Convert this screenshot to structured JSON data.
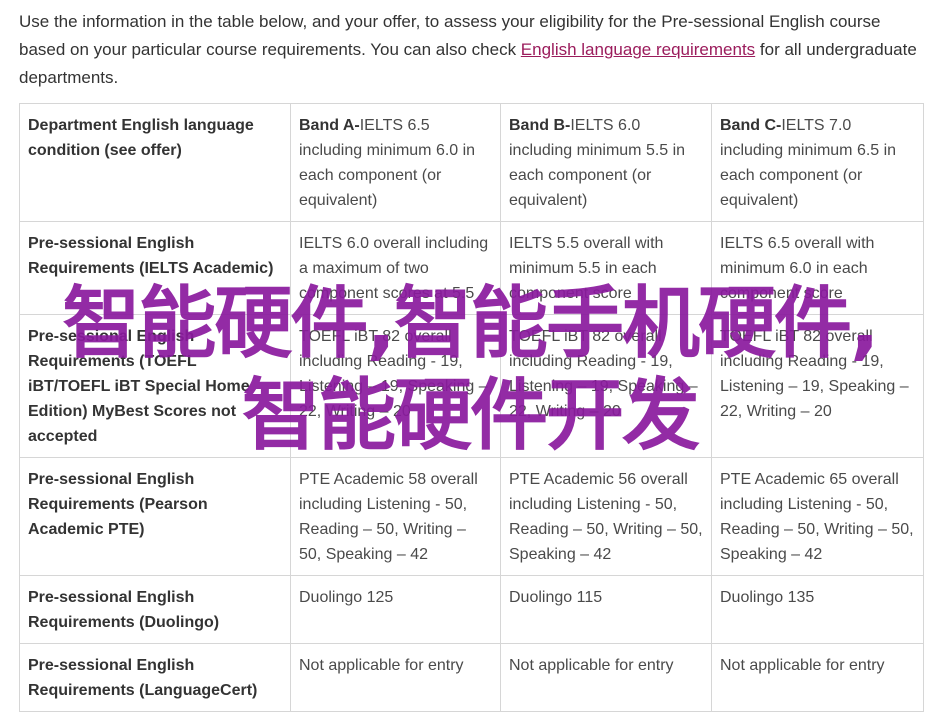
{
  "intro": {
    "text_before": "Use the information in the table below, and your offer, to assess your eligibility for the Pre-sessional English course based on your particular course requirements. You can also check ",
    "link": "English language requirements",
    "text_after": " for all undergraduate departments."
  },
  "table": {
    "header": {
      "label": "Department English language condition (see offer)",
      "bands": [
        {
          "name": "Band A-",
          "text": "IELTS 6.5 including minimum 6.0 in each component (or equivalent)"
        },
        {
          "name": "Band B-",
          "text": "IELTS 6.0 including minimum 5.5 in each component (or equivalent)"
        },
        {
          "name": "Band C-",
          "text": "IELTS 7.0 including minimum 6.5 in each component (or equivalent)"
        }
      ]
    },
    "rows": [
      {
        "label": "Pre-sessional English Requirements (IELTS Academic)",
        "cells": [
          "IELTS 6.0 overall including a maximum of two component scores at 5.5",
          "IELTS 5.5 overall with minimum 5.5 in each component score",
          "IELTS 6.5 overall with minimum 6.0 in each component score"
        ]
      },
      {
        "label": "Pre-sessional English Requirements (TOEFL iBT/TOEFL iBT Special Home Edition) MyBest Scores not accepted",
        "cells": [
          "TOEFL iBT 82 overall including Reading - 19, Listening – 19, Speaking – 22, Writing – 20",
          "TOEFL iBT 82 overall including Reading - 19, Listening – 19, Speaking – 22, Writing – 20",
          "TOEFL iBT 82 overall including Reading - 19, Listening – 19, Speaking – 22, Writing – 20"
        ]
      },
      {
        "label": "Pre-sessional English Requirements (Pearson Academic PTE)",
        "cells": [
          "PTE Academic 58 overall including Listening - 50, Reading – 50, Writing – 50, Speaking – 42",
          "PTE Academic 56 overall including Listening - 50, Reading – 50, Writing – 50, Speaking – 42",
          "PTE Academic 65 overall including Listening - 50, Reading – 50, Writing – 50, Speaking – 42"
        ]
      },
      {
        "label": "Pre-sessional English Requirements (Duolingo)",
        "cells": [
          "Duolingo 125",
          "Duolingo 115",
          "Duolingo 135"
        ]
      },
      {
        "label": "Pre-sessional English Requirements (LanguageCert)",
        "cells": [
          "Not applicable for entry",
          "Not applicable for entry",
          "Not applicable for entry"
        ]
      }
    ]
  },
  "watermark": "智能硬件,智能手机硬件,智能硬件开发",
  "colors": {
    "link": "#9b1c5c",
    "watermark": "#8a1a9e",
    "border": "#d6d6d6"
  }
}
